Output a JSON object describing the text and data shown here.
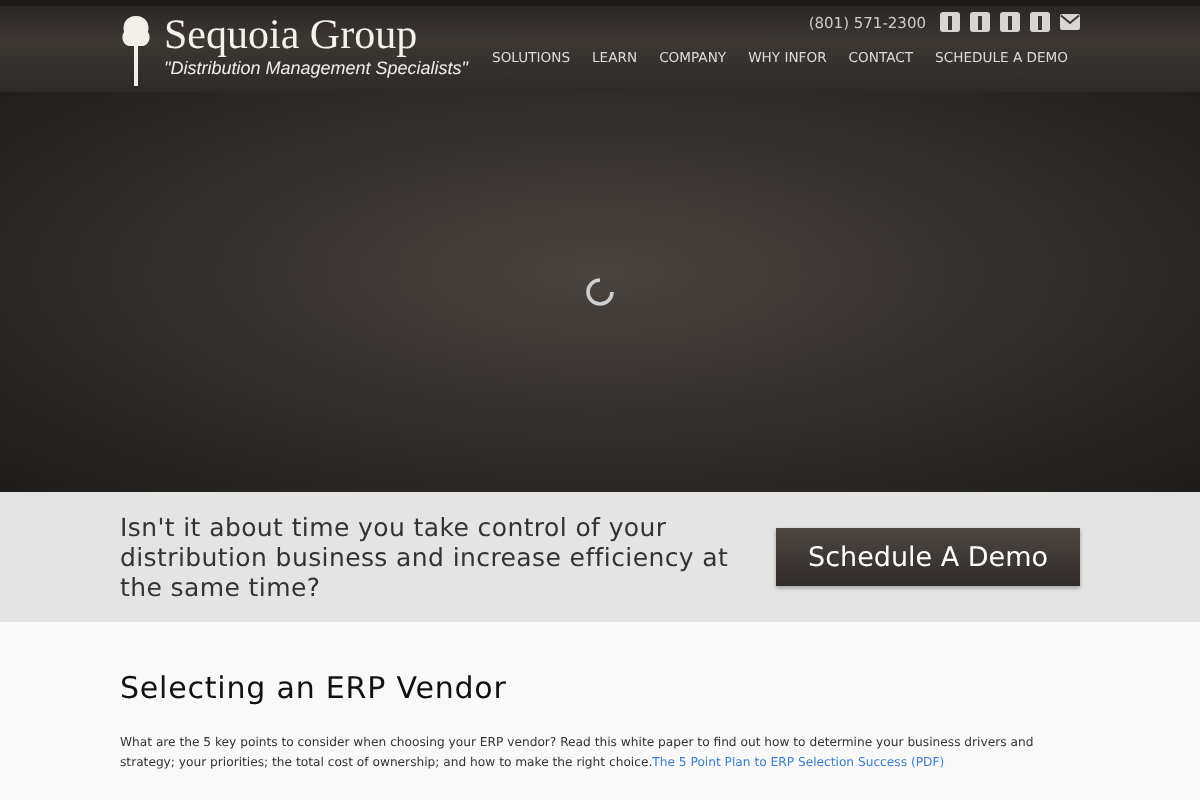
{
  "header": {
    "logo_title": "Sequoia Group",
    "logo_tagline": "\"Distribution Management Specialists\"",
    "phone": "(801) 571-2300",
    "nav": [
      {
        "label": "SOLUTIONS"
      },
      {
        "label": "LEARN"
      },
      {
        "label": "COMPANY"
      },
      {
        "label": "WHY INFOR"
      },
      {
        "label": "CONTACT"
      },
      {
        "label": "SCHEDULE A DEMO"
      }
    ]
  },
  "hero": {
    "kind": "loading"
  },
  "cta": {
    "text": "Isn't it about time you take control of your distribution business and increase efficiency at the same time?",
    "button": "Schedule A Demo"
  },
  "article": {
    "heading": "Selecting an ERP Vendor",
    "body": "What are the 5 key points to consider when choosing your ERP vendor? Read this white paper to find out how to determine your business drivers and strategy; your priorities; the total cost of ownership; and how to make the right choice.",
    "link": "The 5 Point Plan to ERP Selection Success (PDF)"
  }
}
